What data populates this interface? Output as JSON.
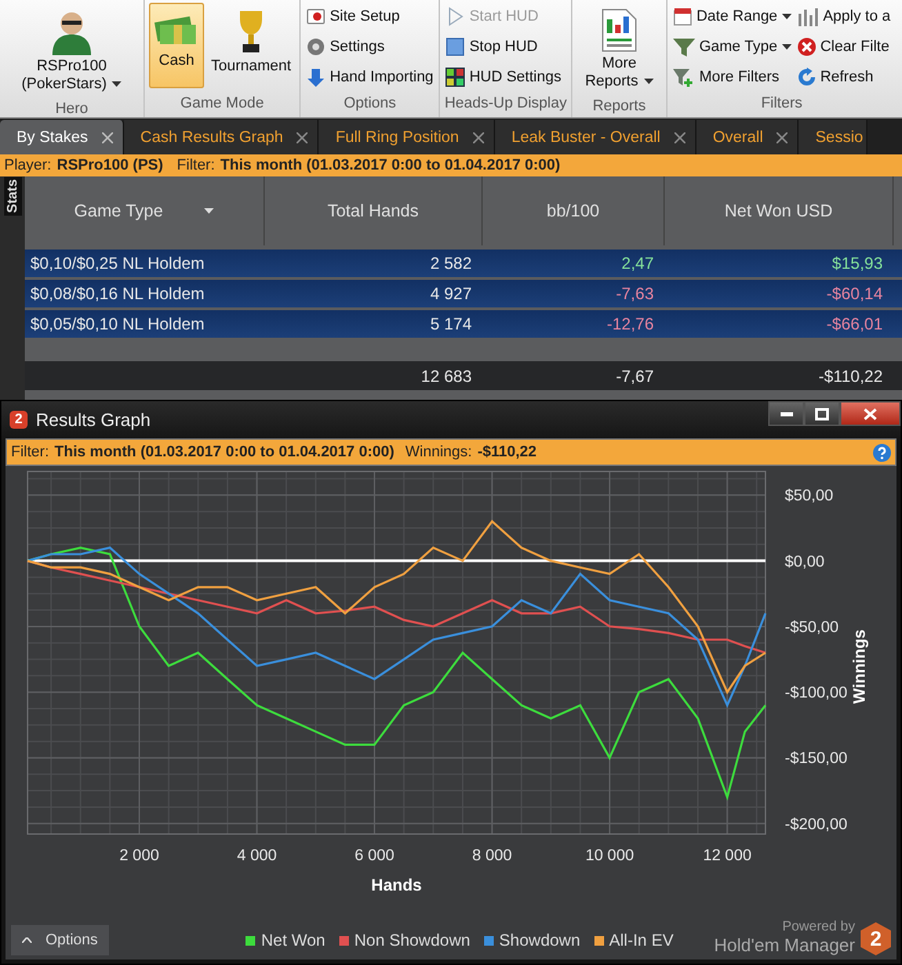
{
  "ribbon": {
    "groups": [
      {
        "label": "Hero",
        "items": [
          {
            "kind": "large",
            "label": "RSPro100 (PokerStars)",
            "dropdown": true
          }
        ]
      },
      {
        "label": "Game Mode",
        "items": [
          {
            "kind": "large",
            "label": "Cash",
            "selected": true
          },
          {
            "kind": "large",
            "label": "Tournament",
            "selected": false
          }
        ]
      },
      {
        "label": "Options",
        "items": [
          {
            "kind": "small",
            "label": "Site Setup"
          },
          {
            "kind": "small",
            "label": "Settings"
          },
          {
            "kind": "small",
            "label": "Hand Importing"
          }
        ]
      },
      {
        "label": "Heads-Up Display",
        "items": [
          {
            "kind": "small",
            "label": "Start HUD",
            "disabled": true
          },
          {
            "kind": "small",
            "label": "Stop HUD",
            "disabled": false
          },
          {
            "kind": "small",
            "label": "HUD Settings",
            "disabled": false
          }
        ]
      },
      {
        "label": "Reports",
        "items": [
          {
            "kind": "large",
            "label": "More Reports",
            "dropdown": true
          }
        ]
      },
      {
        "label": "Filters",
        "items": [
          {
            "kind": "small",
            "label": "Date Range",
            "dropdown": true
          },
          {
            "kind": "small",
            "label": "Game Type",
            "dropdown": true
          },
          {
            "kind": "small",
            "label": "More Filters",
            "dropdown": false
          },
          {
            "kind": "small",
            "label": "Apply to a",
            "dropdown": false
          },
          {
            "kind": "small",
            "label": "Clear Filte",
            "dropdown": false
          },
          {
            "kind": "small",
            "label": "Refresh",
            "dropdown": false
          }
        ]
      }
    ]
  },
  "tabs": [
    {
      "label": "By Stakes",
      "selected": true,
      "closable": true
    },
    {
      "label": "Cash Results Graph",
      "selected": false,
      "closable": true
    },
    {
      "label": "Full Ring Position",
      "selected": false,
      "closable": true
    },
    {
      "label": "Leak Buster - Overall",
      "selected": false,
      "closable": true
    },
    {
      "label": "Overall",
      "selected": false,
      "closable": true
    },
    {
      "label": "Sessio",
      "selected": false,
      "closable": false
    }
  ],
  "filter_bar": [
    {
      "label": "Player:",
      "value": "RSPro100 (PS)"
    },
    {
      "label": "Filter:",
      "value": "This month (01.03.2017 0:00 to 01.04.2017 0:00)"
    }
  ],
  "side_panel": {
    "label": "Stats"
  },
  "grid": {
    "columns": [
      {
        "label": "Game Type",
        "dropdown": true
      },
      {
        "label": "Total Hands",
        "dropdown": false
      },
      {
        "label": "bb/100",
        "dropdown": false
      },
      {
        "label": "Net Won USD",
        "dropdown": false
      }
    ],
    "rows": [
      {
        "cells": [
          "$0,10/$0,25 NL Holdem",
          "2 582",
          "2,47",
          "$15,93"
        ],
        "selected": true,
        "positive": true
      },
      {
        "cells": [
          "$0,08/$0,16 NL Holdem",
          "4 927",
          "-7,63",
          "-$60,14"
        ],
        "selected": true,
        "positive": false
      },
      {
        "cells": [
          "$0,05/$0,10 NL Holdem",
          "5 174",
          "-12,76",
          "-$66,01"
        ],
        "selected": true,
        "positive": false
      }
    ],
    "totals": [
      "12 683",
      "-7,67",
      "-$110,22"
    ]
  },
  "graph_window": {
    "title": "Results Graph",
    "badge": "2",
    "filter": [
      {
        "label": "Filter:",
        "value": "This month (01.03.2017 0:00 to 01.04.2017 0:00)"
      },
      {
        "label": "Winnings:",
        "value": "-$110,22"
      }
    ],
    "chart_data": {
      "type": "line",
      "xlabel": "Hands",
      "ylabel": "Winnings",
      "x": [
        100,
        500,
        1000,
        1500,
        2000,
        2500,
        3000,
        3500,
        4000,
        4500,
        5000,
        5500,
        6000,
        6500,
        7000,
        7500,
        8000,
        8500,
        9000,
        9500,
        10000,
        10500,
        11000,
        11500,
        12000,
        12300,
        12650
      ],
      "series": [
        {
          "name": "Net Won",
          "color": "#3ddc3d",
          "values": [
            0,
            5,
            10,
            5,
            -50,
            -80,
            -70,
            -90,
            -110,
            -120,
            -130,
            -140,
            -140,
            -110,
            -100,
            -70,
            -90,
            -110,
            -120,
            -110,
            -150,
            -100,
            -90,
            -120,
            -180,
            -130,
            -110
          ]
        },
        {
          "name": "Non Showdown",
          "color": "#e05050",
          "values": [
            0,
            -5,
            -10,
            -15,
            -20,
            -25,
            -30,
            -35,
            -40,
            -30,
            -40,
            -38,
            -35,
            -45,
            -50,
            -40,
            -30,
            -40,
            -40,
            -35,
            -50,
            -52,
            -55,
            -60,
            -60,
            -65,
            -70
          ]
        },
        {
          "name": "Showdown",
          "color": "#3a8fdc",
          "values": [
            0,
            5,
            5,
            10,
            -10,
            -25,
            -40,
            -60,
            -80,
            -75,
            -70,
            -80,
            -90,
            -75,
            -60,
            -55,
            -50,
            -30,
            -40,
            -10,
            -30,
            -35,
            -40,
            -60,
            -110,
            -80,
            -40
          ]
        },
        {
          "name": "All-In EV",
          "color": "#f0a040",
          "values": [
            0,
            -5,
            -5,
            -10,
            -20,
            -30,
            -20,
            -20,
            -30,
            -25,
            -20,
            -40,
            -20,
            -10,
            10,
            0,
            30,
            10,
            0,
            -5,
            -10,
            5,
            -20,
            -50,
            -100,
            -80,
            -70
          ]
        }
      ],
      "xlim": [
        100,
        12650
      ],
      "ylim": [
        -208,
        68
      ],
      "xticks": [
        {
          "value": 2000,
          "label": "2 000"
        },
        {
          "value": 4000,
          "label": "4 000"
        },
        {
          "value": 6000,
          "label": "6 000"
        },
        {
          "value": 8000,
          "label": "8 000"
        },
        {
          "value": 10000,
          "label": "10 000"
        },
        {
          "value": 12000,
          "label": "12 000"
        }
      ],
      "yticks": [
        {
          "value": 50,
          "label": "$50,00"
        },
        {
          "value": 0,
          "label": "$0,00"
        },
        {
          "value": -50,
          "label": "-$50,00"
        },
        {
          "value": -100,
          "label": "-$100,00"
        },
        {
          "value": -150,
          "label": "-$150,00"
        },
        {
          "value": -200,
          "label": "-$200,00"
        }
      ],
      "grid": true
    },
    "options_button": "Options",
    "branding": {
      "caption": "Powered by",
      "name": "Hold'em Manager",
      "logo": "2"
    }
  }
}
